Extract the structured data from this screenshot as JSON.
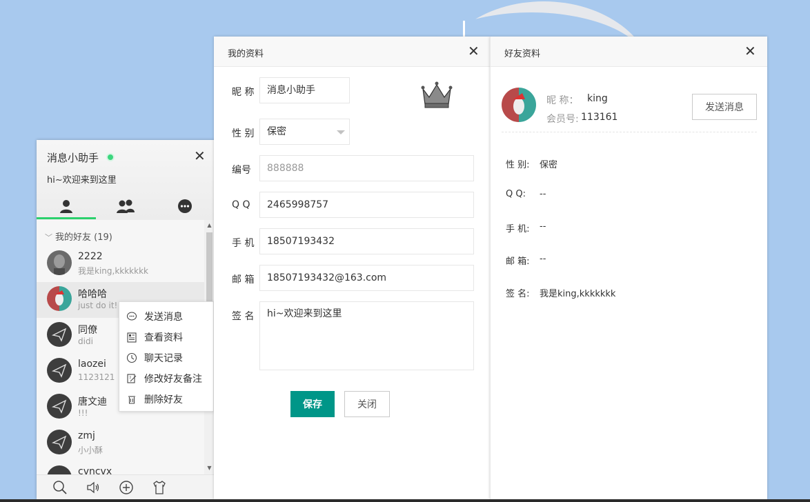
{
  "main": {
    "name": "消息小助手",
    "signature": "hi~欢迎来到这里",
    "group": {
      "title": "我的好友 (19)"
    },
    "friends": [
      {
        "name": "2222",
        "sign": "我是king,kkkkkkk"
      },
      {
        "name": "哈哈哈",
        "sign": "just do it!!"
      },
      {
        "name": "同僚",
        "sign": "didi"
      },
      {
        "name": "laozei",
        "sign": "1123121"
      },
      {
        "name": "唐文迪",
        "sign": "!!!"
      },
      {
        "name": "zmj",
        "sign": "小小酥"
      },
      {
        "name": "cvncvx",
        "sign": ""
      }
    ]
  },
  "context_menu": {
    "items": [
      {
        "label": "发送消息",
        "icon": "chat-bubble-icon"
      },
      {
        "label": "查看资料",
        "icon": "profile-card-icon"
      },
      {
        "label": "聊天记录",
        "icon": "clock-icon"
      },
      {
        "label": "修改好友备注",
        "icon": "edit-note-icon"
      },
      {
        "label": "删除好友",
        "icon": "trash-icon"
      }
    ]
  },
  "my_profile": {
    "title": "我的资料",
    "nickname_label": "昵 称",
    "nickname": "消息小助手",
    "gender_label": "性 别",
    "gender": "保密",
    "id_label": "编号",
    "id": "888888",
    "qq_label": "Q  Q",
    "qq": "2465998757",
    "phone_label": "手 机",
    "phone": "18507193432",
    "email_label": "邮 箱",
    "email": "18507193432@163.com",
    "sign_label": "签 名",
    "sign": "hi~欢迎来到这里",
    "save_label": "保存",
    "close_label": "关闭"
  },
  "friend_profile": {
    "title": "好友资料",
    "nick_label": "昵  称：",
    "nick": "king",
    "member_label": "会员号:",
    "member_no": "113161",
    "send_label": "发送消息",
    "rows": [
      {
        "label": "性  别:",
        "value": "保密"
      },
      {
        "label": "Q    Q:",
        "value": "--"
      },
      {
        "label": "手  机:",
        "value": "--"
      },
      {
        "label": "邮  箱:",
        "value": "--"
      },
      {
        "label": "签  名:",
        "value": "我是king,kkkkkkk"
      }
    ]
  },
  "colors": {
    "accent": "#009688",
    "online": "#3cd67e",
    "tab_active": "#2bd06c",
    "desktop": "#a8c9ee"
  }
}
